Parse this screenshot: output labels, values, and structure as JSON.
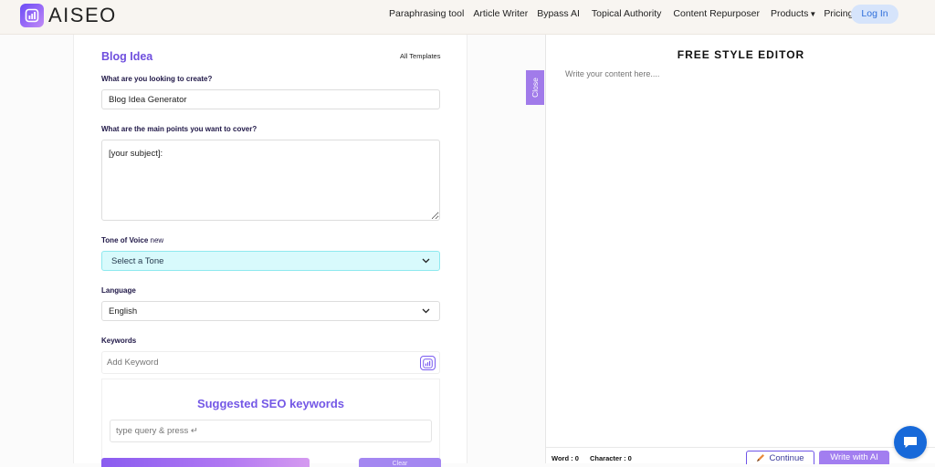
{
  "header": {
    "logo_text": "AISEO",
    "nav": [
      {
        "label": "Paraphrasing tool"
      },
      {
        "label": "Article Writer"
      },
      {
        "label": "Bypass AI"
      },
      {
        "label": "Topical Authority"
      },
      {
        "label": "Content Repurposer"
      },
      {
        "label": "Products",
        "has_dropdown": true
      },
      {
        "label": "Pricing"
      }
    ],
    "login_label": "Log In"
  },
  "form": {
    "title": "Blog Idea",
    "all_templates": "All Templates",
    "create_label": "What are you looking to create?",
    "create_value": "Blog Idea Generator",
    "points_label": "What are the main points you want to cover?",
    "points_value": "[your subject]:",
    "tone_label": "Tone of Voice",
    "tone_badge": "new",
    "tone_value": "Select a Tone",
    "language_label": "Language",
    "language_value": "English",
    "keywords_label": "Keywords",
    "keyword_placeholder": "Add Keyword",
    "seo_title": "Suggested SEO keywords",
    "seo_placeholder": "type query & press ↵",
    "clear_label": "Clear"
  },
  "editor": {
    "close_label": "Close",
    "title": "FREE STYLE EDITOR",
    "placeholder": "Write your content here....",
    "word_count_label": "Word : 0",
    "char_count_label": "Character : 0",
    "continue_label": "Continue",
    "write_ai_label": "Write with AI"
  },
  "colors": {
    "brand_purple": "#6f4fde",
    "tone_select_bg": "#d8fafc",
    "login_bg": "#d6e4fb",
    "chat_blue": "#1769d9"
  },
  "icons": [
    "aiseo-logo-icon",
    "chevron-down-icon",
    "ai-keyword-icon",
    "continue-pen-icon",
    "chat-icon"
  ]
}
